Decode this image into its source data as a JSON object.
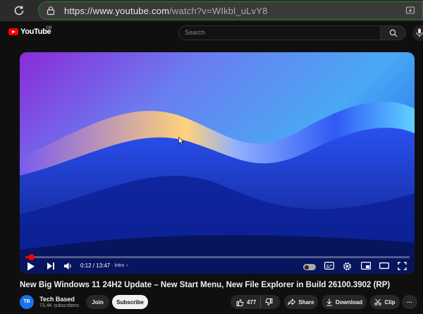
{
  "browser": {
    "url_host": "https://www.youtube.com",
    "url_path": "/watch?v=WIkbl_uLvY8"
  },
  "header": {
    "logo_text": "YouTube",
    "region": "GB",
    "search_placeholder": "Search"
  },
  "player": {
    "progress_fraction": 0.015,
    "current_time": "0:12",
    "duration": "13:47",
    "time_display": "0:12 / 13:47",
    "chapter": "Intro",
    "chapter_chevron": "›"
  },
  "video": {
    "title": "New Big Windows 11 24H2 Update – New Start Menu, New File Explorer in Build 26100.3902 (RP)"
  },
  "channel": {
    "avatar_text": "TB",
    "name": "Tech Based",
    "subscribers": "73.4K subscribers",
    "join_label": "Join",
    "subscribe_label": "Subscribe"
  },
  "actions": {
    "like_count": "477",
    "share_label": "Share",
    "download_label": "Download",
    "clip_label": "Clip",
    "more_label": "···"
  },
  "colors": {
    "brand_red": "#ff0000",
    "address_border": "#2e7d32",
    "background": "#0f0f0f"
  }
}
